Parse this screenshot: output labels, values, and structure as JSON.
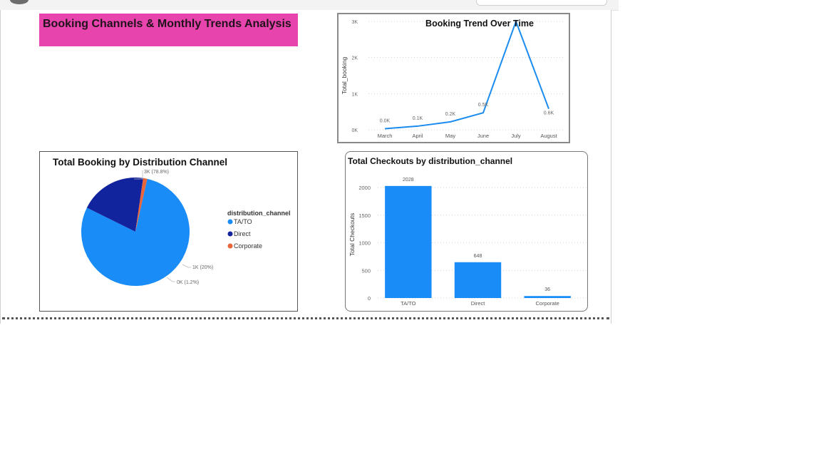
{
  "dashboard": {
    "title": "Booking Channels & Monthly Trends Analysis"
  },
  "trend_chart": {
    "title": "Booking Trend Over Time",
    "y_axis_label": "Total_booking",
    "y_ticks": [
      "0K",
      "1K",
      "2K",
      "3K"
    ],
    "x_labels": [
      "March",
      "April",
      "May",
      "June",
      "July",
      "August"
    ],
    "data_labels": [
      "0.0K",
      "0.1K",
      "0.2K",
      "0.5K",
      "0.6K"
    ],
    "line_color": "#1a8cf0"
  },
  "pie_chart": {
    "title": "Total Booking by Distribution Channel",
    "legend_title": "distribution_channel",
    "slices": [
      {
        "name": "TA/TO",
        "color": "#1a8cf7",
        "label": "3K (78.8%)"
      },
      {
        "name": "Direct",
        "color": "#12239e",
        "label": "1K (20%)"
      },
      {
        "name": "Corporate",
        "color": "#e8643b",
        "label": "0K (1.2%)"
      }
    ]
  },
  "bar_chart": {
    "title": "Total Checkouts by distribution_channel",
    "y_axis_label": "Total Checkouts",
    "y_ticks": [
      "0",
      "500",
      "1000",
      "1500",
      "2000"
    ],
    "bar_color": "#1a8cf7"
  },
  "chart_data": [
    {
      "type": "line",
      "title": "Booking Trend Over Time",
      "xlabel": "",
      "ylabel": "Total_booking",
      "x": [
        "March",
        "April",
        "May",
        "June",
        "July",
        "August"
      ],
      "series": [
        {
          "values": [
            30,
            100,
            220,
            470,
            3000,
            580
          ]
        }
      ],
      "ylim": [
        0,
        3000
      ],
      "grid": true
    },
    {
      "type": "pie",
      "title": "Total Booking by Distribution Channel",
      "categories": [
        "TA/TO",
        "Direct",
        "Corporate"
      ],
      "values": [
        78.8,
        20,
        1.2
      ],
      "legend": "right"
    },
    {
      "type": "bar",
      "title": "Total Checkouts by distribution_channel",
      "xlabel": "",
      "ylabel": "Total Checkouts",
      "categories": [
        "TA/TO",
        "Direct",
        "Corporate"
      ],
      "values": [
        2028,
        648,
        36
      ],
      "ylim": [
        0,
        2000
      ],
      "grid": true
    }
  ]
}
